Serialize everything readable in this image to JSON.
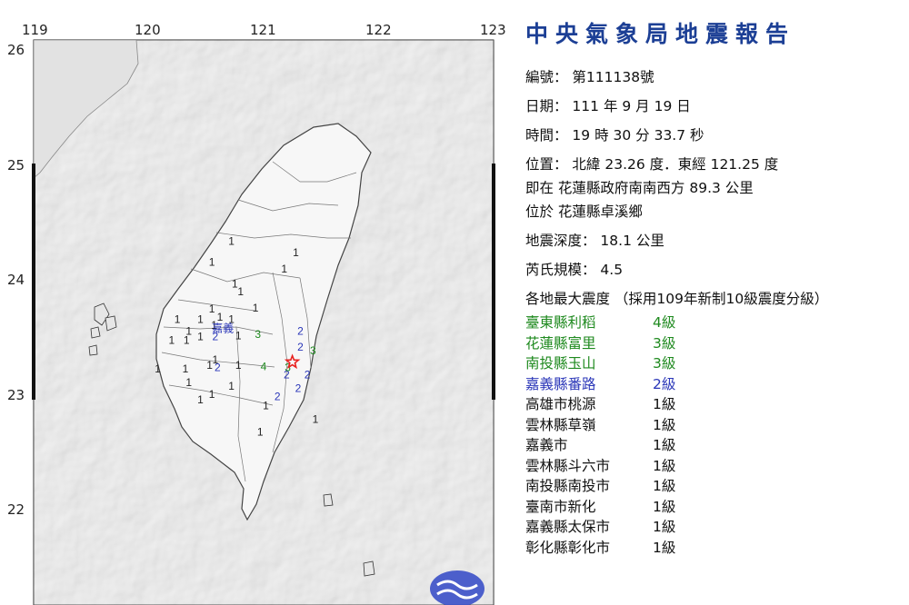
{
  "map": {
    "lon_ticks": [
      "119",
      "120",
      "121",
      "122",
      "123"
    ],
    "lat_ticks": [
      "26",
      "25",
      "24",
      "23",
      "22"
    ],
    "lon_range": [
      119,
      123
    ],
    "lat_range": [
      21.2,
      26
    ],
    "epicenter": {
      "lon": 121.25,
      "lat": 23.26,
      "marker": "star-icon",
      "color": "#e8221f"
    },
    "intensity_colors": {
      "1": "#222222",
      "2": "#2a36b8",
      "3": "#1f8a1f",
      "4": "#1f8a1f"
    },
    "station_marks": [
      {
        "lon": 120.55,
        "lat": 24.1,
        "level": "1"
      },
      {
        "lon": 120.72,
        "lat": 24.28,
        "level": "1"
      },
      {
        "lon": 120.75,
        "lat": 23.91,
        "level": "1"
      },
      {
        "lon": 120.8,
        "lat": 23.84,
        "level": "1"
      },
      {
        "lon": 120.93,
        "lat": 23.7,
        "level": "1"
      },
      {
        "lon": 121.18,
        "lat": 24.04,
        "level": "1"
      },
      {
        "lon": 121.28,
        "lat": 24.18,
        "level": "1"
      },
      {
        "lon": 120.25,
        "lat": 23.6,
        "level": "1"
      },
      {
        "lon": 120.35,
        "lat": 23.5,
        "level": "1"
      },
      {
        "lon": 120.45,
        "lat": 23.6,
        "level": "1"
      },
      {
        "lon": 120.55,
        "lat": 23.69,
        "level": "1"
      },
      {
        "lon": 120.62,
        "lat": 23.62,
        "level": "1"
      },
      {
        "lon": 120.72,
        "lat": 23.6,
        "level": "1"
      },
      {
        "lon": 120.2,
        "lat": 23.42,
        "level": "1"
      },
      {
        "lon": 120.33,
        "lat": 23.42,
        "level": "1"
      },
      {
        "lon": 120.45,
        "lat": 23.45,
        "level": "1"
      },
      {
        "lon": 120.57,
        "lat": 23.55,
        "level": "1"
      },
      {
        "lon": 120.78,
        "lat": 23.46,
        "level": "1"
      },
      {
        "lon": 120.08,
        "lat": 23.17,
        "level": "1"
      },
      {
        "lon": 120.32,
        "lat": 23.17,
        "level": "1"
      },
      {
        "lon": 120.53,
        "lat": 23.2,
        "level": "1"
      },
      {
        "lon": 120.78,
        "lat": 23.2,
        "level": "1"
      },
      {
        "lon": 120.35,
        "lat": 23.05,
        "level": "1"
      },
      {
        "lon": 120.55,
        "lat": 22.95,
        "level": "1"
      },
      {
        "lon": 120.45,
        "lat": 22.9,
        "level": "1"
      },
      {
        "lon": 120.72,
        "lat": 23.02,
        "level": "1"
      },
      {
        "lon": 121.02,
        "lat": 22.85,
        "level": "1"
      },
      {
        "lon": 121.45,
        "lat": 22.73,
        "level": "1"
      },
      {
        "lon": 120.97,
        "lat": 22.62,
        "level": "1"
      },
      {
        "lon": 120.58,
        "lat": 23.25,
        "level": "1"
      },
      {
        "lon": 120.58,
        "lat": 23.45,
        "level": "2"
      },
      {
        "lon": 120.6,
        "lat": 23.18,
        "level": "2"
      },
      {
        "lon": 121.32,
        "lat": 23.5,
        "level": "2"
      },
      {
        "lon": 121.32,
        "lat": 23.36,
        "level": "2"
      },
      {
        "lon": 121.2,
        "lat": 23.12,
        "level": "2"
      },
      {
        "lon": 121.38,
        "lat": 23.12,
        "level": "2"
      },
      {
        "lon": 121.3,
        "lat": 23.0,
        "level": "2"
      },
      {
        "lon": 121.12,
        "lat": 22.93,
        "level": "2"
      },
      {
        "lon": 120.95,
        "lat": 23.47,
        "level": "3"
      },
      {
        "lon": 121.21,
        "lat": 23.18,
        "level": "3"
      },
      {
        "lon": 121.43,
        "lat": 23.33,
        "level": "3"
      },
      {
        "lon": 121.0,
        "lat": 23.19,
        "level": "4"
      }
    ],
    "place_label": "嘉義",
    "place_label_pos": {
      "lon": 120.55,
      "lat": 23.52
    }
  },
  "report": {
    "title": "中央氣象局地震報告",
    "number": "編號： 第111138號",
    "date": "日期： 111 年 9 月 19 日",
    "time": "時間： 19 時 30 分 33.7 秒",
    "location": "位置： 北緯 23.26 度．東經 121.25 度",
    "relative": "即在 花蓮縣政府南南西方 89.3 公里",
    "region": "位於 花蓮縣卓溪鄉",
    "depth": "地震深度： 18.1 公里",
    "magnitude": "芮氏規模： 4.5",
    "intensity_header": "各地最大震度 （採用109年新制10級震度分級）",
    "stations": [
      {
        "name": "臺東縣利稻",
        "level": "4級",
        "color": "#1f8a1f"
      },
      {
        "name": "花蓮縣富里",
        "level": "3級",
        "color": "#1f8a1f"
      },
      {
        "name": "南投縣玉山",
        "level": "3級",
        "color": "#1f8a1f"
      },
      {
        "name": "嘉義縣番路",
        "level": "2級",
        "color": "#2a36b8"
      },
      {
        "name": "高雄市桃源",
        "level": "1級",
        "color": "#111111"
      },
      {
        "name": "雲林縣草嶺",
        "level": "1級",
        "color": "#111111"
      },
      {
        "name": "嘉義市",
        "level": "1級",
        "color": "#111111"
      },
      {
        "name": "雲林縣斗六市",
        "level": "1級",
        "color": "#111111"
      },
      {
        "name": "南投縣南投市",
        "level": "1級",
        "color": "#111111"
      },
      {
        "name": "臺南市新化",
        "level": "1級",
        "color": "#111111"
      },
      {
        "name": "嘉義縣太保市",
        "level": "1級",
        "color": "#111111"
      },
      {
        "name": "彰化縣彰化市",
        "level": "1級",
        "color": "#111111"
      }
    ]
  },
  "logo": {
    "icon": "cwb-logo-icon",
    "color": "#3b50c8"
  }
}
